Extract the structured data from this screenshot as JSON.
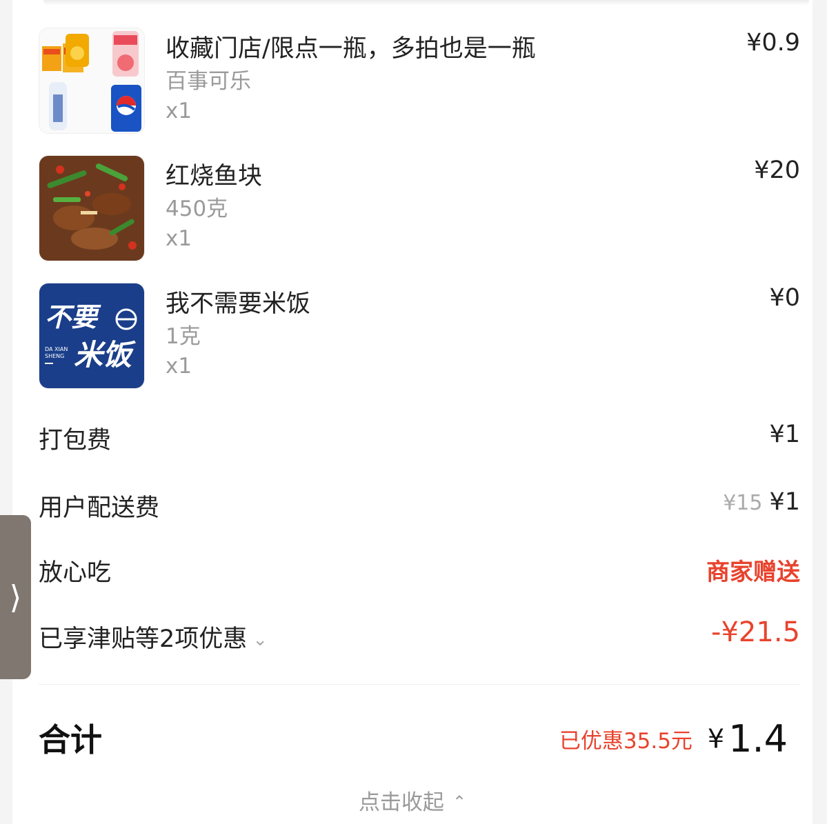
{
  "items": [
    {
      "name": "收藏门店/限点一瓶，多拍也是一瓶",
      "spec": "百事可乐",
      "qty": "x1",
      "price": "¥0.9"
    },
    {
      "name": "红烧鱼块",
      "spec": "450克",
      "qty": "x1",
      "price": "¥20"
    },
    {
      "name": "我不需要米饭",
      "spec": "1克",
      "qty": "x1",
      "price": "¥0"
    }
  ],
  "rice_image": {
    "text_line1": "不要",
    "text_line2": "米饭",
    "brand_line1": "DA XIAN",
    "brand_line2": "SHENG"
  },
  "fees": {
    "packing_label": "打包费",
    "packing_value": "¥1",
    "delivery_label": "用户配送费",
    "delivery_original": "¥15",
    "delivery_value": "¥1",
    "assurance_label": "放心吃",
    "assurance_value": "商家赠送",
    "discount_label": "已享津贴等2项优惠",
    "discount_value": "-¥21.5"
  },
  "total": {
    "label": "合计",
    "saved": "已优惠35.5元",
    "currency": "¥",
    "amount": "1.4"
  },
  "collapse_label": "点击收起",
  "colors": {
    "accent": "#e8432d",
    "rice_bg": "#1a3e8a",
    "side_tab": "#7f7770"
  }
}
